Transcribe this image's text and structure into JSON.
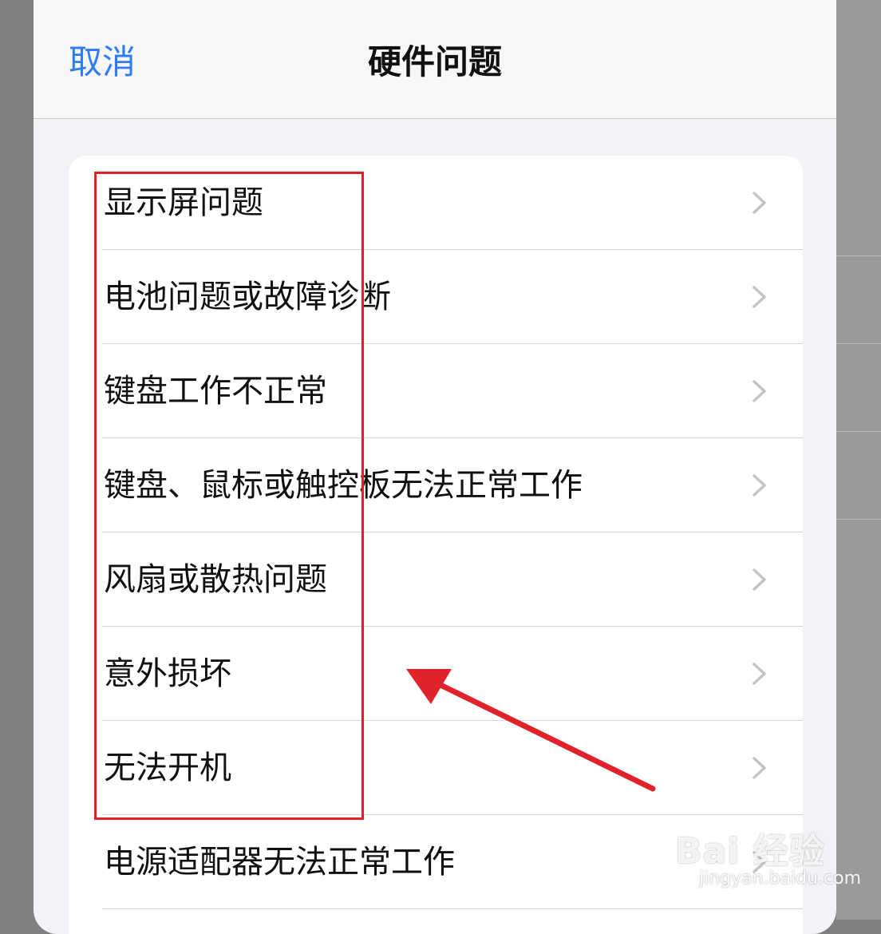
{
  "header": {
    "cancel_label": "取消",
    "title": "硬件问题"
  },
  "list": {
    "items": [
      {
        "label": "显示屏问题"
      },
      {
        "label": "电池问题或故障诊断"
      },
      {
        "label": "键盘工作不正常"
      },
      {
        "label": "键盘、鼠标或触控板无法正常工作"
      },
      {
        "label": "风扇或散热问题"
      },
      {
        "label": "意外损坏"
      },
      {
        "label": "无法开机"
      },
      {
        "label": "电源适配器无法正常工作"
      }
    ]
  },
  "watermark": {
    "logo_text": "Bai 经验",
    "url_text": "jingyan.baidu.com"
  },
  "colors": {
    "accent": "#2f7cf6",
    "annotation": "#e0232b",
    "background": "#f2f2f7"
  }
}
